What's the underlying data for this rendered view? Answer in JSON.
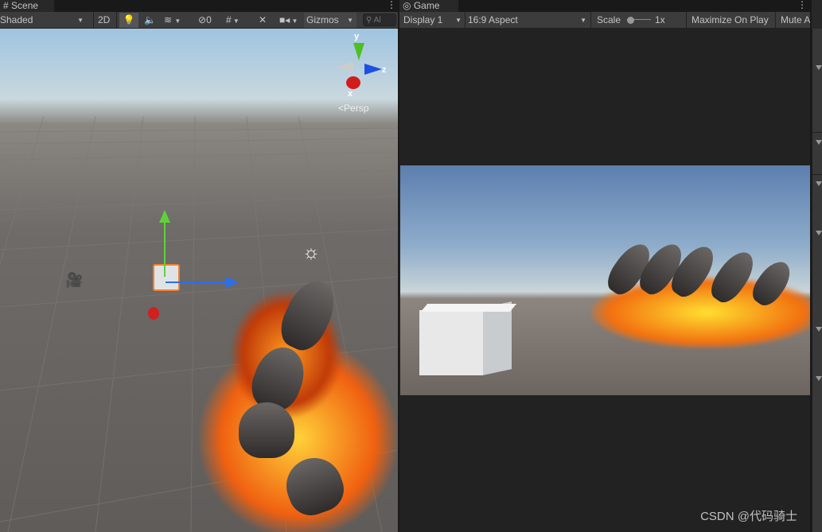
{
  "scene_panel": {
    "tab_label": "Scene",
    "shading_mode": "Shaded",
    "btn_2d": "2D",
    "hidden_count": "0",
    "gizmos_label": "Gizmos",
    "search_placeholder": "Al",
    "gizmo": {
      "y_label": "y",
      "x_label": "x",
      "z_label": "z",
      "projection_label": "Persp"
    }
  },
  "game_panel": {
    "tab_label": "Game",
    "display": "Display 1",
    "aspect": "16:9 Aspect",
    "scale_label": "Scale",
    "scale_value": "1x",
    "maximize_label": "Maximize On Play",
    "mute_label": "Mute A"
  },
  "watermark": "CSDN @代码骑士",
  "colors": {
    "toolbar": "#3c3c3c",
    "tab": "#282828",
    "sky": "#9fc4e0",
    "ground": "#6f6b68"
  }
}
